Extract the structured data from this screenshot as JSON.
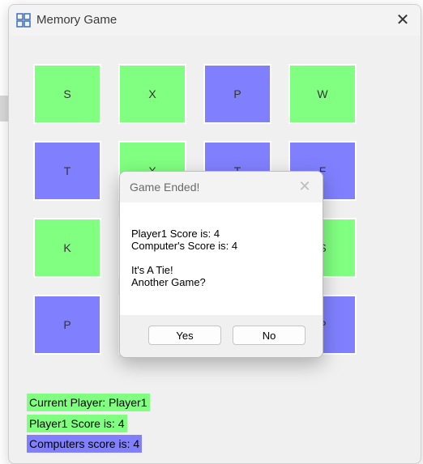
{
  "window": {
    "title": "Memory Game",
    "app_icon": "memory-game-app-icon",
    "close_icon": "close-icon"
  },
  "colors": {
    "green": "#80ff80",
    "blue": "#8080ff",
    "window_bg": "#f0f0f0"
  },
  "board": {
    "cards": [
      {
        "label": "S",
        "color": "green"
      },
      {
        "label": "X",
        "color": "green"
      },
      {
        "label": "P",
        "color": "blue"
      },
      {
        "label": "W",
        "color": "green"
      },
      {
        "label": "T",
        "color": "blue"
      },
      {
        "label": "X",
        "color": "green"
      },
      {
        "label": "T",
        "color": "blue"
      },
      {
        "label": "F",
        "color": "blue"
      },
      {
        "label": "K",
        "color": "green"
      },
      {
        "label": "",
        "color": "green"
      },
      {
        "label": "",
        "color": "green"
      },
      {
        "label": "S",
        "color": "green"
      },
      {
        "label": "P",
        "color": "blue"
      },
      {
        "label": "",
        "color": "green"
      },
      {
        "label": "",
        "color": "blue"
      },
      {
        "label": "P",
        "color": "blue"
      }
    ]
  },
  "status": {
    "current_player": "Current Player: Player1",
    "player1_score": "Player1 Score is: 4",
    "computer_score": "Computers score is: 4"
  },
  "dialog": {
    "title": "Game Ended!",
    "lines": [
      "Player1 Score is: 4",
      "Computer's Score is: 4",
      "",
      "It's A Tie!",
      "Another Game?"
    ],
    "yes_label": "Yes",
    "no_label": "No"
  }
}
